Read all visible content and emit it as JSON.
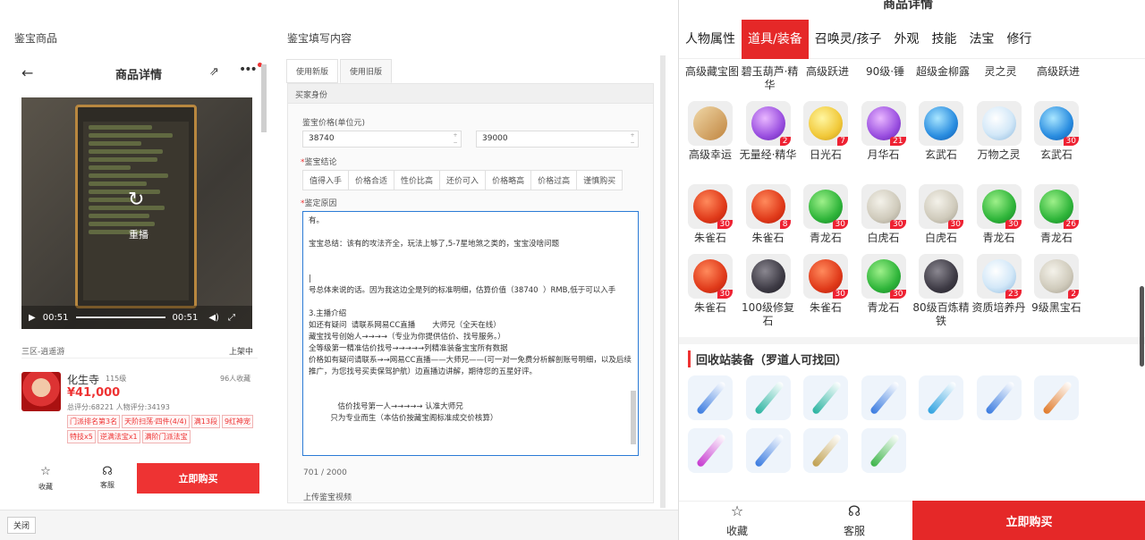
{
  "left": {
    "section_goods": "鉴宝商品",
    "section_form": "鉴宝填写内容",
    "phone": {
      "title": "商品详情",
      "replay_label": "重播",
      "time_current": "00:51",
      "time_total": "00:51",
      "server": "三区-逍遥游",
      "status": "上架中",
      "name": "化生寺",
      "level": "115级",
      "favorites": "96人收藏",
      "price": "¥41,000",
      "scores": "总评分:68221   人物评分:34193",
      "tags": [
        "门派排名第3名",
        "天阶扫荡·四件(4/4)",
        "满13段",
        "9红神宠",
        "特技x5",
        "逆满法宝x1",
        "满阶门派法宝"
      ],
      "fav_label": "收藏",
      "service_label": "客服",
      "buy_label": "立即购买"
    },
    "form": {
      "tabs": [
        "使用新版",
        "使用旧版"
      ],
      "buyer_identity": "买家身份",
      "price_label": "鉴宝价格(单位元)",
      "price_min": "38740",
      "price_max": "39000",
      "conclusion_label": "鉴宝结论",
      "verdicts": [
        "值得入手",
        "价格合适",
        "性价比高",
        "还价可入",
        "价格略高",
        "价格过高",
        "谨慎购买"
      ],
      "reason_label": "鉴定原因",
      "reason_lines": [
        "有。",
        "",
        "宝宝总结：该有的攻法齐全，玩法上够了,5-7星地煞之类的，宝宝没啥问题",
        "",
        "",
        "|",
        "号总体来说的话。因为我这边全是列的标准明细，估算价值（38740  ）RMB,低于可以入手",
        "",
        "3.主播介绍",
        "如还有疑问  请联系网易CC直播       大师兄（全天在线）",
        "藏宝找号创始人→→→→（专业为你提供估价、找号服务。）",
        "全等级第一精准估价找号→→→→→列精准装备宝宝所有数据",
        "价格如有疑问请联系→→网易CC直播——大师兄——(可一对一免费分析解剖账号明细，以及后续推广，为您找号买卖保驾护航）边直播边讲解，期待您的五星好评。",
        "",
        "",
        "            估价找号第一人→→→→→ 认准大师兄",
        "         只为专业而生（本估价按藏宝阁标准成交价核算）"
      ],
      "char_count": "701 / 2000",
      "upload_label": "上传鉴宝视频"
    },
    "close_label": "关闭"
  },
  "right": {
    "title": "商品详情",
    "tabs": [
      "人物属性",
      "道具/装备",
      "召唤灵/孩子",
      "外观",
      "技能",
      "法宝",
      "修行"
    ],
    "active_tab": 1,
    "partial_names": [
      "高级藏宝图",
      "碧玉葫芦·精华",
      "高级跃进",
      "90级·锤",
      "超级金柳露",
      "灵之灵",
      "高级跃进"
    ],
    "items": [
      {
        "name": "高级幸运",
        "badge": "",
        "kind": "scroll"
      },
      {
        "name": "无量经·精华",
        "badge": "2",
        "kind": "purple"
      },
      {
        "name": "日光石",
        "badge": "7",
        "kind": "yellow"
      },
      {
        "name": "月华石",
        "badge": "21",
        "kind": "purple"
      },
      {
        "name": "玄武石",
        "badge": "",
        "kind": "blue"
      },
      {
        "name": "万物之灵",
        "badge": "",
        "kind": "crystal"
      },
      {
        "name": "玄武石",
        "badge": "30",
        "kind": "blue"
      },
      {
        "name": "朱雀石",
        "badge": "30",
        "kind": "red"
      },
      {
        "name": "朱雀石",
        "badge": "8",
        "kind": "red"
      },
      {
        "name": "青龙石",
        "badge": "30",
        "kind": "green"
      },
      {
        "name": "白虎石",
        "badge": "30",
        "kind": "white"
      },
      {
        "name": "白虎石",
        "badge": "30",
        "kind": "white"
      },
      {
        "name": "青龙石",
        "badge": "30",
        "kind": "green"
      },
      {
        "name": "青龙石",
        "badge": "26",
        "kind": "green"
      },
      {
        "name": "朱雀石",
        "badge": "30",
        "kind": "red"
      },
      {
        "name": "100级修复石",
        "badge": "",
        "kind": "dark"
      },
      {
        "name": "朱雀石",
        "badge": "30",
        "kind": "red"
      },
      {
        "name": "青龙石",
        "badge": "30",
        "kind": "green"
      },
      {
        "name": "80级百炼精铁",
        "badge": "",
        "kind": "dark"
      },
      {
        "name": "资质培养丹",
        "badge": "23",
        "kind": "crystal"
      },
      {
        "name": "9级黑宝石",
        "badge": "2",
        "kind": "white"
      }
    ],
    "recycle_title": "回收站装备（罗道人可找回）",
    "weapons": [
      {
        "color": "#3a7be0"
      },
      {
        "color": "#29b3a0"
      },
      {
        "color": "#29b3a0"
      },
      {
        "color": "#3a7be0"
      },
      {
        "color": "#2fa2e0"
      },
      {
        "color": "#3a7be0"
      },
      {
        "color": "#e07a2a"
      },
      {
        "color": "#c63ad0"
      },
      {
        "color": "#3a7be0"
      },
      {
        "color": "#c0a050"
      },
      {
        "color": "#3db54a"
      }
    ],
    "fav_label": "收藏",
    "service_label": "客服",
    "buy_label": "立即购买"
  }
}
